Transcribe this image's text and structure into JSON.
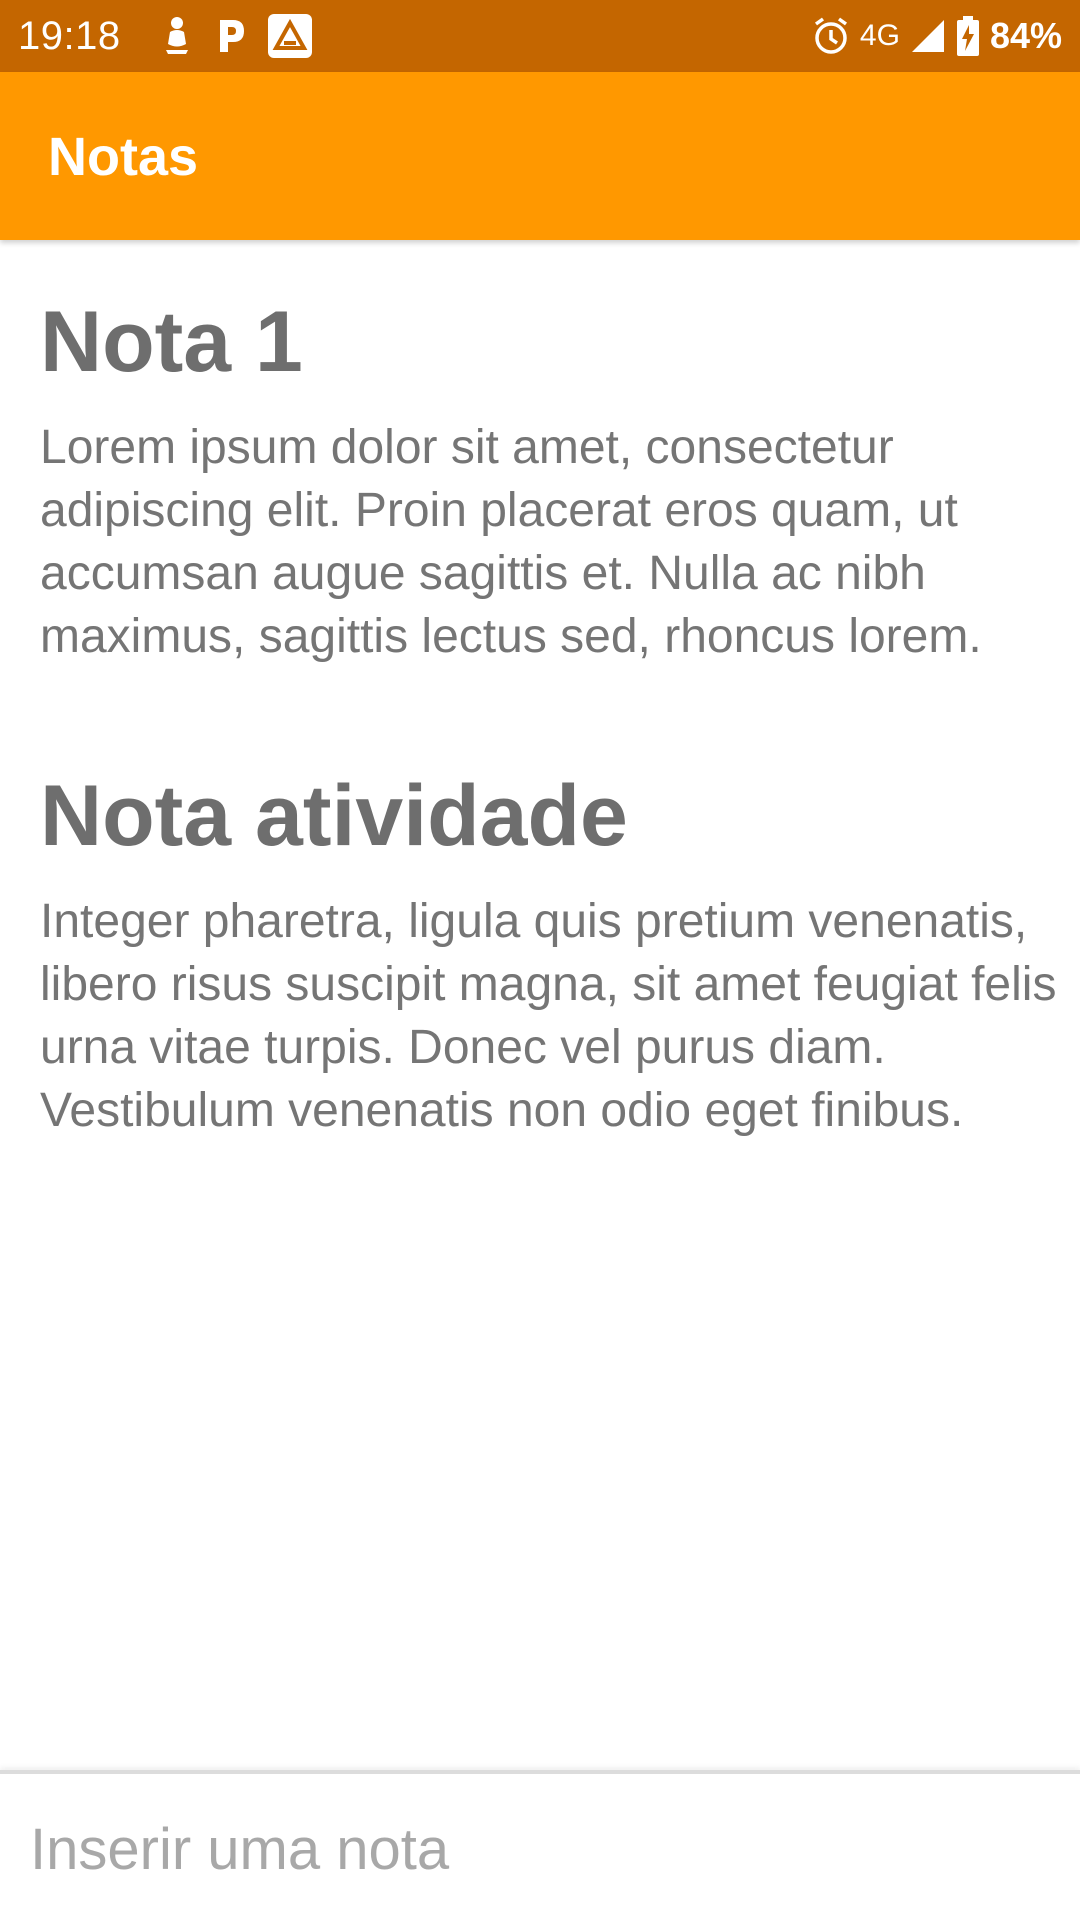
{
  "status_bar": {
    "time": "19:18",
    "network": "4G",
    "battery": "84%",
    "left_icons": [
      "status-figure-icon",
      "parking-p-icon",
      "app-triangle-icon"
    ],
    "right_icons": [
      "alarm-clock-icon",
      "signal-icon",
      "battery-charging-icon"
    ]
  },
  "app_bar": {
    "title": "Notas",
    "color": "#ff9800"
  },
  "notes": [
    {
      "title": "Nota 1",
      "body": "Lorem ipsum dolor sit amet, consectetur adipiscing elit. Proin placerat eros quam, ut accumsan augue sagittis et. Nulla ac nibh maximus, sagittis lectus sed, rhoncus lorem."
    },
    {
      "title": "Nota atividade",
      "body": "Integer pharetra, ligula quis pretium venenatis, libero risus suscipit magna, sit amet feugiat felis urna vitae turpis. Donec vel purus diam. Vestibulum venenatis non odio eget finibus."
    }
  ],
  "input": {
    "placeholder": "Inserir uma nota",
    "value": ""
  }
}
